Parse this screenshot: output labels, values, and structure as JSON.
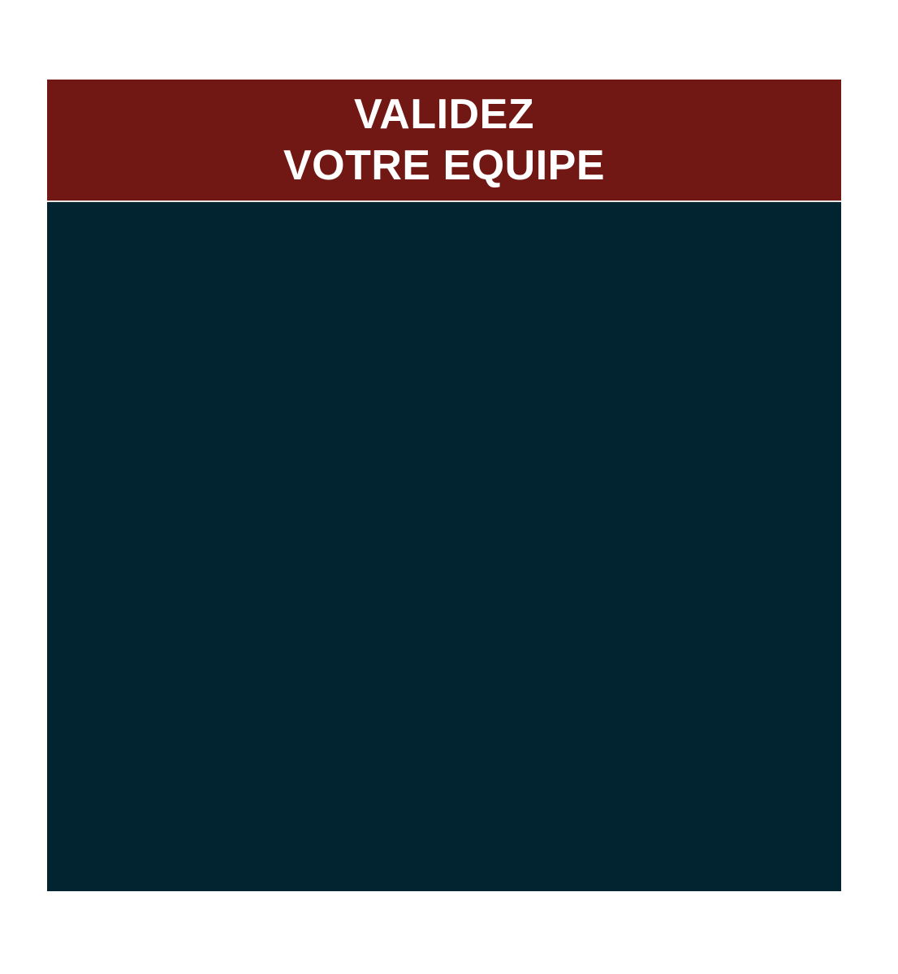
{
  "banner": {
    "title_line1": "VALIDEZ",
    "title_line2": "VOTRE EQUIPE"
  },
  "colors": {
    "header_bg": "#711714",
    "panel_bg": "#022330",
    "title_text": "#ffffff",
    "page_bg": "#ffffff"
  }
}
